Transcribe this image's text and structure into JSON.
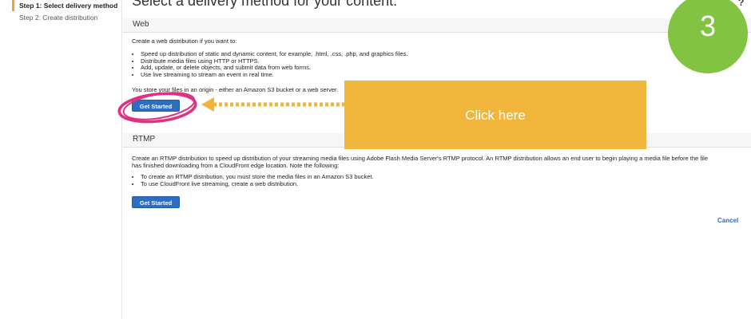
{
  "sidebar": {
    "steps": [
      {
        "label": "Step 1: Select delivery method",
        "active": true
      },
      {
        "label": "Step 2: Create distribution",
        "active": false
      }
    ]
  },
  "header": {
    "title": "Select a delivery method for your content.",
    "help_glyph": "?"
  },
  "web": {
    "heading": "Web",
    "intro": "Create a web distribution if you want to:",
    "bullets": [
      "Speed up distribution of static and dynamic content, for example, .html, .css, .php, and graphics files.",
      "Distribute media files using HTTP or HTTPS.",
      "Add, update, or delete objects, and submit data from web forms.",
      "Use live streaming to stream an event in real time."
    ],
    "origin_note": "You store your files in an origin - either an Amazon S3 bucket or a web server.",
    "button": "Get Started"
  },
  "rtmp": {
    "heading": "RTMP",
    "intro_line1": "Create an RTMP distribution to speed up distribution of your streaming media files using Adobe Flash Media Server's RTMP protocol. An RTMP distribution allows an end user to begin playing a media file before the file",
    "intro_line2": "has finished downloading from a CloudFront edge location. Note the following:",
    "bullets": [
      "To create an RTMP distribution, you must store the media files in an Amazon S3 bucket.",
      "To use CloudFront live streaming, create a web distribution."
    ],
    "button": "Get Started"
  },
  "footer": {
    "cancel": "Cancel"
  },
  "annotations": {
    "callout_text": "Click here",
    "step_number": "3",
    "colors": {
      "callout": "#f1b53c",
      "arrow": "#f1b53c",
      "circle": "#82c341",
      "highlight": "#e0317f"
    }
  }
}
